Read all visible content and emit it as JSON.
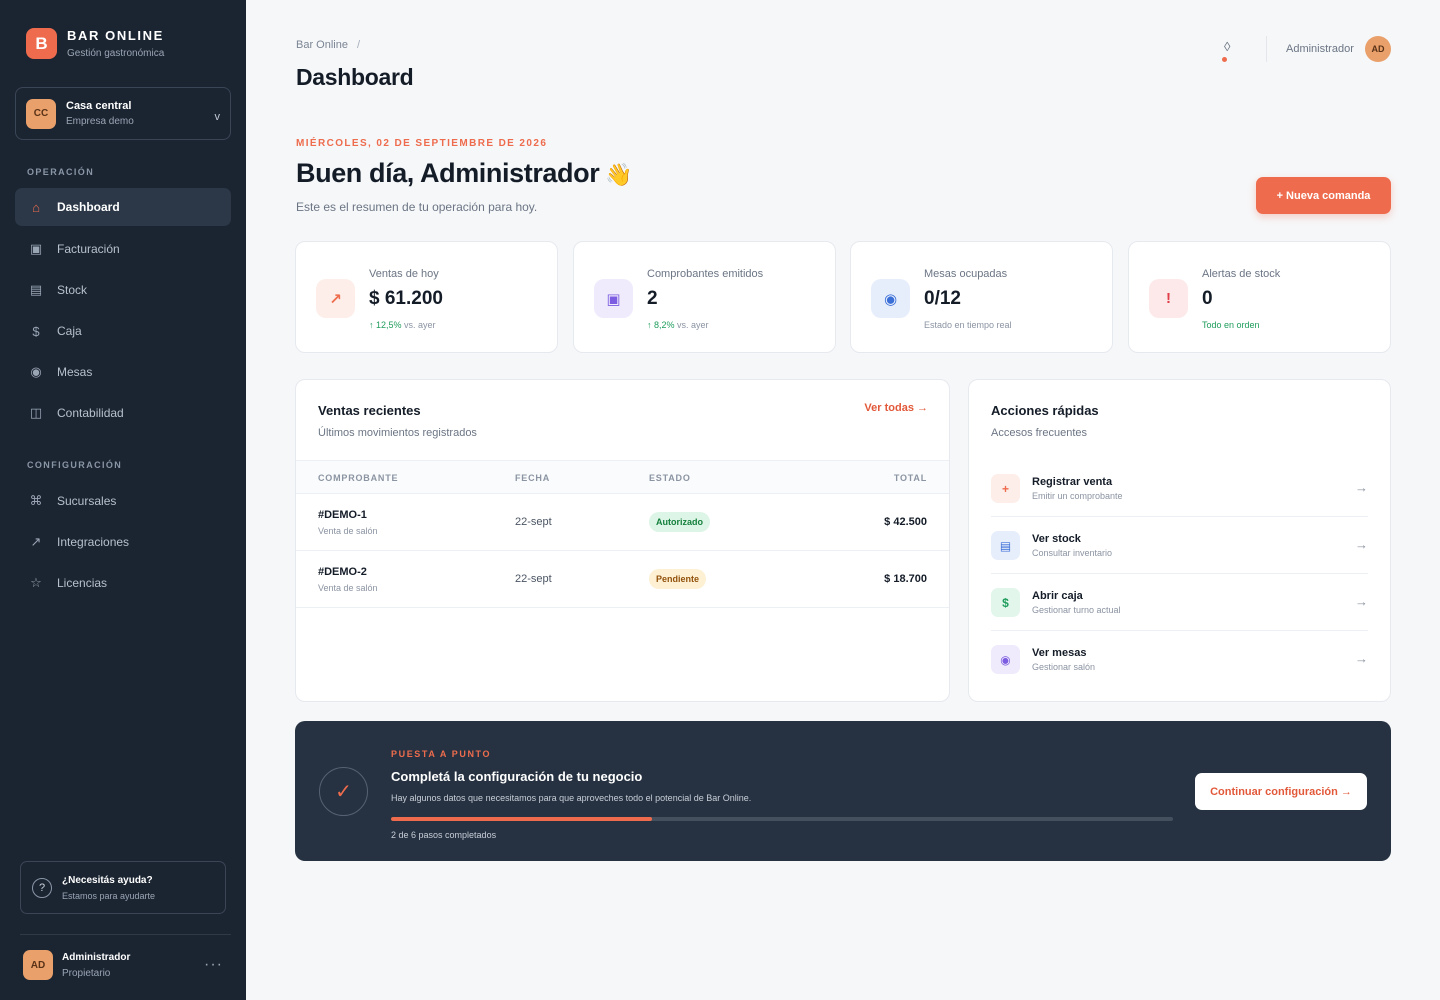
{
  "brand": {
    "logo_letter": "B",
    "name": "BAR ONLINE",
    "subtitle": "Gestión gastronómica",
    "accent": "#ee6c4d"
  },
  "company": {
    "initials": "CC",
    "name": "Casa central",
    "subtitle": "Empresa demo",
    "chevron": "v"
  },
  "sidebar": {
    "sections": [
      {
        "label": "OPERACIÓN",
        "items": [
          {
            "label": "Dashboard",
            "icon": "home-icon",
            "glyph": "⌂",
            "active": true
          },
          {
            "label": "Facturación",
            "icon": "invoice-icon",
            "glyph": "▣"
          },
          {
            "label": "Stock",
            "icon": "stock-icon",
            "glyph": "▤"
          },
          {
            "label": "Caja",
            "icon": "dollar-icon",
            "glyph": "$"
          },
          {
            "label": "Mesas",
            "icon": "table-icon",
            "glyph": "◉"
          },
          {
            "label": "Contabilidad",
            "icon": "book-icon",
            "glyph": "◫"
          }
        ]
      },
      {
        "label": "CONFIGURACIÓN",
        "items": [
          {
            "label": "Sucursales",
            "icon": "command-icon",
            "glyph": "⌘"
          },
          {
            "label": "Integraciones",
            "icon": "arrow-up-right-icon",
            "glyph": "↗"
          },
          {
            "label": "Licencias",
            "icon": "star-icon",
            "glyph": "☆"
          }
        ]
      }
    ],
    "help": {
      "icon": "help-icon",
      "glyph": "?",
      "title": "¿Necesitás ayuda?",
      "subtitle": "Estamos para ayudarte"
    },
    "user": {
      "initials": "AD",
      "name": "Administrador",
      "role": "Propietario",
      "more": "···"
    }
  },
  "header": {
    "breadcrumb": "Bar Online",
    "breadcrumb_sep": "/",
    "title": "Dashboard",
    "user_name": "Administrador",
    "user_initials": "AD",
    "notification_glyph": "◊"
  },
  "greeting": {
    "date": "MIÉRCOLES, 02 DE SEPTIEMBRE DE 2026",
    "title": "Buen día, Administrador",
    "wave": "👋",
    "subtitle": "Este es el resumen de tu operación para hoy.",
    "new_order_label": "+   Nueva comanda"
  },
  "stats": [
    {
      "label": "Ventas de hoy",
      "value": "$ 61.200",
      "trend": "↑ 12,5%",
      "note": " vs. ayer",
      "icon": "trend-up-icon",
      "glyph": "↗",
      "color": "#ee6c4d",
      "bg": "#fdeee9"
    },
    {
      "label": "Comprobantes emitidos",
      "value": "2",
      "trend": "↑ 8,2%",
      "note": " vs. ayer",
      "icon": "receipt-icon",
      "glyph": "▣",
      "color": "#7c5ce0",
      "bg": "#efeafc"
    },
    {
      "label": "Mesas ocupadas",
      "value": "0/12",
      "trend": "",
      "note": "Estado en tiempo real",
      "icon": "table-icon",
      "glyph": "◉",
      "color": "#3b6fd8",
      "bg": "#e7eefb"
    },
    {
      "label": "Alertas de stock",
      "value": "0",
      "trend": "",
      "note": "Todo en orden",
      "note_green": true,
      "icon": "alert-icon",
      "glyph": "!",
      "color": "#e0404a",
      "bg": "#fde9ea"
    }
  ],
  "recent_sales": {
    "title": "Ventas recientes",
    "subtitle": "Últimos movimientos registrados",
    "see_all": "Ver todas →",
    "columns": [
      "COMPROBANTE",
      "FECHA",
      "ESTADO",
      "TOTAL"
    ],
    "rows": [
      {
        "id": "#DEMO-1",
        "desc": "Venta de salón",
        "date": "22-sept",
        "status": "Autorizado",
        "status_kind": "ok",
        "total": "$ 42.500"
      },
      {
        "id": "#DEMO-2",
        "desc": "Venta de salón",
        "date": "22-sept",
        "status": "Pendiente",
        "status_kind": "pending",
        "total": "$ 18.700"
      }
    ]
  },
  "quick_actions": {
    "title": "Acciones rápidas",
    "subtitle": "Accesos frecuentes",
    "arrow": "→",
    "items": [
      {
        "title": "Registrar venta",
        "subtitle": "Emitir un comprobante",
        "icon": "plus-icon",
        "glyph": "+",
        "color": "#ee6c4d",
        "bg": "#fdeee9"
      },
      {
        "title": "Ver stock",
        "subtitle": "Consultar inventario",
        "icon": "stock-icon",
        "glyph": "▤",
        "color": "#3b6fd8",
        "bg": "#e7eefb"
      },
      {
        "title": "Abrir caja",
        "subtitle": "Gestionar turno actual",
        "icon": "dollar-icon",
        "glyph": "$",
        "color": "#1f9d5c",
        "bg": "#e2f6ec"
      },
      {
        "title": "Ver mesas",
        "subtitle": "Gestionar salón",
        "icon": "table-icon",
        "glyph": "◉",
        "color": "#7c5ce0",
        "bg": "#efeafc"
      }
    ]
  },
  "setup": {
    "check_glyph": "✓",
    "eyebrow": "PUESTA A PUNTO",
    "title": "Completá la configuración de tu negocio",
    "description": "Hay algunos datos que necesitamos para que aproveches todo el potencial de Bar Online.",
    "progress_fraction": 0.3333,
    "steps": "2 de 6 pasos completados",
    "button_label": "Continuar configuración →"
  }
}
